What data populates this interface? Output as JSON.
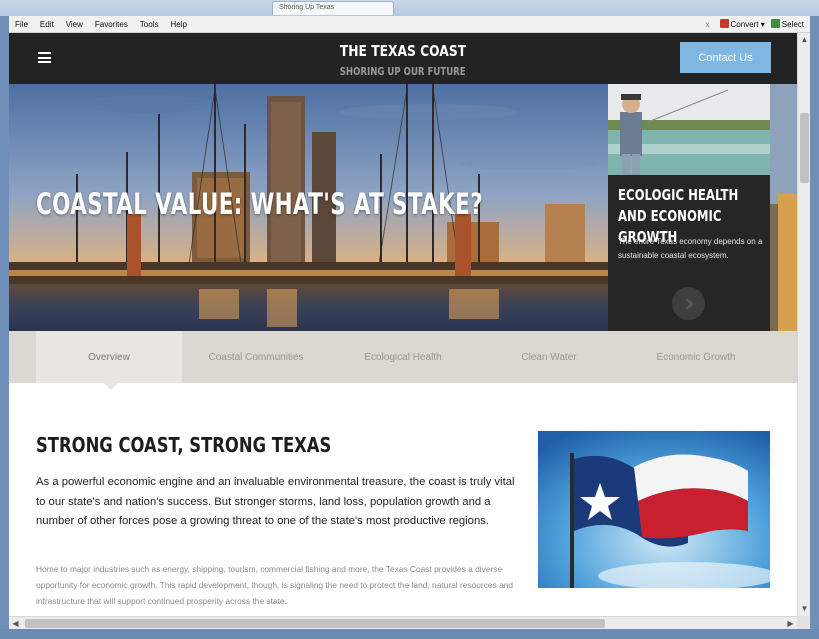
{
  "browser": {
    "tab_title": "Shoring Up Texas",
    "menu": [
      "File",
      "Edit",
      "View",
      "Favorites",
      "Tools",
      "Help"
    ],
    "toolbar_close": "x",
    "convert_label": "Convert",
    "select_label": "Select"
  },
  "header": {
    "logo_line1": "THE TEXAS COAST",
    "logo_line2": "SHORING UP OUR FUTURE",
    "contact_label": "Contact Us"
  },
  "hero": {
    "title": "COASTAL VALUE: WHAT'S AT STAKE?"
  },
  "side_card": {
    "title": "ECOLOGIC HEALTH AND ECONOMIC GROWTH",
    "description": "The entire Texas economy depends on a sustainable coastal ecosystem."
  },
  "tabs": [
    {
      "label": "Overview",
      "active": true
    },
    {
      "label": "Coastal Communities",
      "active": false
    },
    {
      "label": "Ecological Health",
      "active": false
    },
    {
      "label": "Clean Water",
      "active": false
    },
    {
      "label": "Economic Growth",
      "active": false
    }
  ],
  "content": {
    "title": "STRONG COAST, STRONG TEXAS",
    "lead": "As a powerful economic engine and an invaluable environmental treasure, the coast is truly vital to our state's and nation's success. But stronger storms, land loss, population growth and a number of other forces pose a growing threat to one of the state's most productive regions.",
    "body": "Home to major industries such as energy, shipping, tourism, commercial fishing and more, the Texas Coast provides a diverse opportunity for economic growth. This rapid development, though, is signaling the need to protect the land, natural resources and infrastructure that will support continued prosperity across the state."
  },
  "colors": {
    "header_bg": "#232323",
    "contact_bg": "#7fb7e2",
    "tab_bar_bg": "#dcd7d1",
    "tab_active_bg": "#e9e6e2"
  }
}
